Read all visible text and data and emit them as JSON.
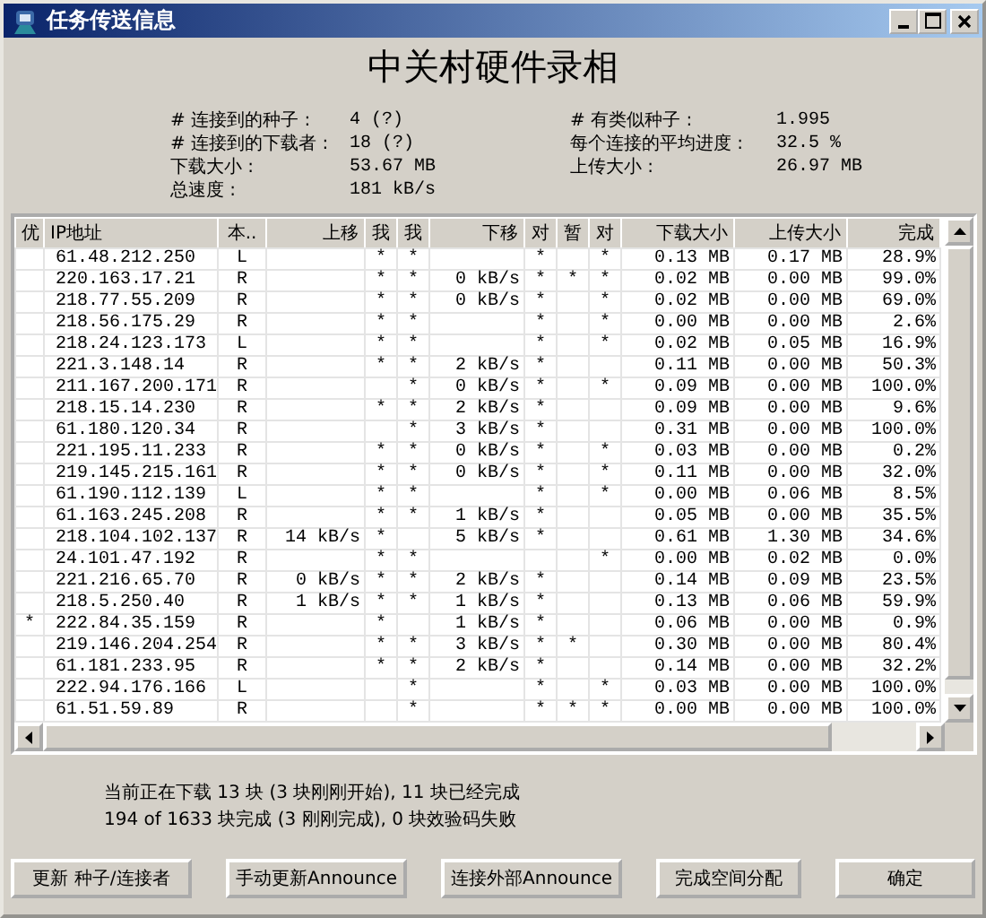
{
  "window": {
    "title": "任务传送信息"
  },
  "heading": "中关村硬件录相",
  "stats_left": [
    {
      "label": "# 连接到的种子 :",
      "value": "4 (?)"
    },
    {
      "label": "# 连接到的下载者 :",
      "value": "18 (?)"
    },
    {
      "label": "下载大小 :",
      "value": "53.67 MB"
    },
    {
      "label": "总速度 :",
      "value": "181 kB/s"
    }
  ],
  "stats_right": [
    {
      "label": "# 有类似种子 :",
      "value": "1.995"
    },
    {
      "label": "每个连接的平均进度 :",
      "value": "32.5 %"
    },
    {
      "label": "上传大小 :",
      "value": "26.97 MB"
    }
  ],
  "table": {
    "columns": [
      "优",
      "IP地址",
      "本..",
      "上移",
      "我",
      "我",
      "下移",
      "对",
      "暂",
      "对",
      "下载大小",
      "上传大小",
      "完成"
    ],
    "rows": [
      {
        "cells": [
          null,
          "61.48.212.250",
          "L",
          null,
          "*",
          "*",
          null,
          "*",
          null,
          "*",
          "0.13 MB",
          "0.17 MB",
          "28.9%"
        ]
      },
      {
        "cells": [
          null,
          "220.163.17.21",
          "R",
          null,
          "*",
          "*",
          "0 kB/s",
          "*",
          "*",
          "*",
          "0.02 MB",
          "0.00 MB",
          "99.0%"
        ]
      },
      {
        "cells": [
          null,
          "218.77.55.209",
          "R",
          null,
          "*",
          "*",
          "0 kB/s",
          "*",
          null,
          "*",
          "0.02 MB",
          "0.00 MB",
          "69.0%"
        ]
      },
      {
        "cells": [
          null,
          "218.56.175.29",
          "R",
          null,
          "*",
          "*",
          null,
          "*",
          null,
          "*",
          "0.00 MB",
          "0.00 MB",
          "2.6%"
        ]
      },
      {
        "cells": [
          null,
          "218.24.123.173",
          "L",
          null,
          "*",
          "*",
          null,
          "*",
          null,
          "*",
          "0.02 MB",
          "0.05 MB",
          "16.9%"
        ]
      },
      {
        "cells": [
          null,
          "221.3.148.14",
          "R",
          null,
          "*",
          "*",
          "2 kB/s",
          "*",
          null,
          null,
          "0.11 MB",
          "0.00 MB",
          "50.3%"
        ]
      },
      {
        "cells": [
          null,
          "211.167.200.171",
          "R",
          null,
          null,
          "*",
          "0 kB/s",
          "*",
          null,
          "*",
          "0.09 MB",
          "0.00 MB",
          "100.0%"
        ]
      },
      {
        "cells": [
          null,
          "218.15.14.230",
          "R",
          null,
          "*",
          "*",
          "2 kB/s",
          "*",
          null,
          null,
          "0.09 MB",
          "0.00 MB",
          "9.6%"
        ]
      },
      {
        "cells": [
          null,
          "61.180.120.34",
          "R",
          null,
          null,
          "*",
          "3 kB/s",
          "*",
          null,
          null,
          "0.31 MB",
          "0.00 MB",
          "100.0%"
        ]
      },
      {
        "cells": [
          null,
          "221.195.11.233",
          "R",
          null,
          "*",
          "*",
          "0 kB/s",
          "*",
          null,
          "*",
          "0.03 MB",
          "0.00 MB",
          "0.2%"
        ]
      },
      {
        "cells": [
          null,
          "219.145.215.161",
          "R",
          null,
          "*",
          "*",
          "0 kB/s",
          "*",
          null,
          "*",
          "0.11 MB",
          "0.00 MB",
          "32.0%"
        ]
      },
      {
        "cells": [
          null,
          "61.190.112.139",
          "L",
          null,
          "*",
          "*",
          null,
          "*",
          null,
          "*",
          "0.00 MB",
          "0.06 MB",
          "8.5%"
        ]
      },
      {
        "cells": [
          null,
          "61.163.245.208",
          "R",
          null,
          "*",
          "*",
          "1 kB/s",
          "*",
          null,
          null,
          "0.05 MB",
          "0.00 MB",
          "35.5%"
        ]
      },
      {
        "cells": [
          null,
          "218.104.102.137",
          "R",
          "14 kB/s",
          "*",
          null,
          "5 kB/s",
          "*",
          null,
          null,
          "0.61 MB",
          "1.30 MB",
          "34.6%"
        ]
      },
      {
        "cells": [
          null,
          "24.101.47.192",
          "R",
          null,
          "*",
          "*",
          null,
          null,
          null,
          "*",
          "0.00 MB",
          "0.02 MB",
          "0.0%"
        ]
      },
      {
        "cells": [
          null,
          "221.216.65.70",
          "R",
          "0 kB/s",
          "*",
          "*",
          "2 kB/s",
          "*",
          null,
          null,
          "0.14 MB",
          "0.09 MB",
          "23.5%"
        ]
      },
      {
        "cells": [
          null,
          "218.5.250.40",
          "R",
          "1 kB/s",
          "*",
          "*",
          "1 kB/s",
          "*",
          null,
          null,
          "0.13 MB",
          "0.06 MB",
          "59.9%"
        ]
      },
      {
        "cells": [
          "*",
          "222.84.35.159",
          "R",
          null,
          "*",
          null,
          "1 kB/s",
          "*",
          null,
          null,
          "0.06 MB",
          "0.00 MB",
          "0.9%"
        ]
      },
      {
        "cells": [
          null,
          "219.146.204.254",
          "R",
          null,
          "*",
          "*",
          "3 kB/s",
          "*",
          "*",
          null,
          "0.30 MB",
          "0.00 MB",
          "80.4%"
        ]
      },
      {
        "cells": [
          null,
          "61.181.233.95",
          "R",
          null,
          "*",
          "*",
          "2 kB/s",
          "*",
          null,
          null,
          "0.14 MB",
          "0.00 MB",
          "32.2%"
        ]
      },
      {
        "cells": [
          null,
          "222.94.176.166",
          "L",
          null,
          null,
          "*",
          null,
          "*",
          null,
          "*",
          "0.03 MB",
          "0.00 MB",
          "100.0%"
        ]
      },
      {
        "cells": [
          null,
          "61.51.59.89",
          "R",
          null,
          null,
          "*",
          null,
          "*",
          "*",
          "*",
          "0.00 MB",
          "0.00 MB",
          "100.0%"
        ]
      }
    ]
  },
  "status_lines": [
    "当前正在下载 13 块 (3 块刚刚开始), 11 块已经完成",
    "194 of 1633 块完成 (3 刚刚完成), 0 块效验码失败"
  ],
  "buttons": [
    "更新 种子/连接者",
    "手动更新Announce",
    "连接外部Announce",
    "完成空间分配",
    "确定"
  ]
}
